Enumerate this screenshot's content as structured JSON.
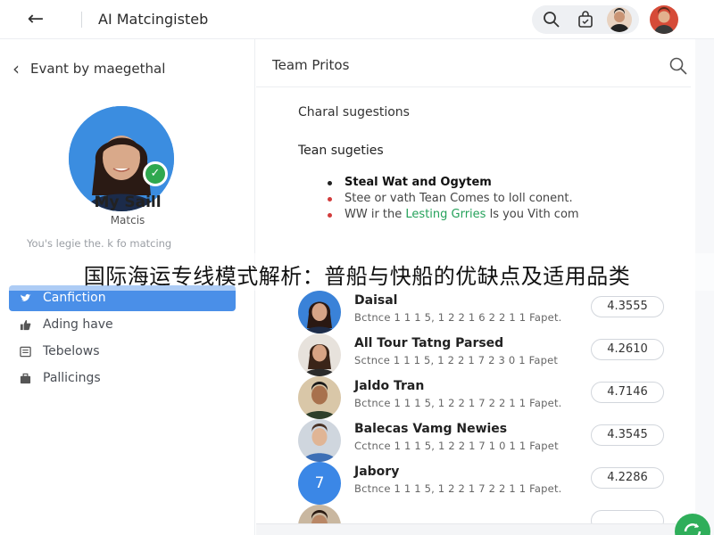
{
  "window": {
    "title": "AI Matcingisteb"
  },
  "left_panel": {
    "header_label": "Evant by maegethal",
    "profile": {
      "name": "My Saill",
      "subtitle": "Matcis",
      "bio": "You's legie the. k fo matcing"
    },
    "nav": [
      {
        "label": "Canfiction",
        "icon": "twitter-icon",
        "active": true
      },
      {
        "label": "Ading have",
        "icon": "thumbs-up-icon",
        "active": false
      },
      {
        "label": "Tebelows",
        "icon": "list-icon",
        "active": false
      },
      {
        "label": "Pallicings",
        "icon": "briefcase-icon",
        "active": false
      }
    ]
  },
  "right_panel": {
    "title": "Team Pritos",
    "section1": "Charal sugestions",
    "section2": "Tean sugeties",
    "bullets": {
      "b1": "Steal Wat and Ogytem",
      "b2": "Stee or vath Tean Comes to loll conent.",
      "b3_pre": "WW ir the ",
      "b3_link": "Lesting Grries",
      "b3_post": " ls you Vith com"
    },
    "people": [
      {
        "name": "Daisal",
        "sub": "Bctnce 1 1 1 5, 1 2 2 1 6  2 2 1 1  Fapet.",
        "score": "4.3555"
      },
      {
        "name": "All Tour Tatng Parsed",
        "sub": "Sctnce 1 1 1 5, 1 2 2 1 7  2 3 0 1  Fapet",
        "score": "4.2610"
      },
      {
        "name": "Jaldo Tran",
        "sub": "Bctnce 1 1 1 5, 1 2 2 1 7  2 2 1 1  Fapet.",
        "score": "4.7146"
      },
      {
        "name": "Balecas Vamg Newies",
        "sub": "Cctnce 1 1 1 5, 1 2 2 1 7  1 0 1 1  Fapet",
        "score": "4.3545"
      },
      {
        "name": "Jabory",
        "sub": "Bctnce 1 1 1 5, 1 2 2 1 7  2 2 1 1  Fapet.",
        "score": "4.2286",
        "avatar_text": "7"
      }
    ]
  },
  "overlay_banner": "国际海运专线模式解析：普船与快船的优缺点及适用品类",
  "colors": {
    "accent_blue": "#4a8fe8",
    "online_green": "#2fa84f",
    "link_green": "#24a15a",
    "bullet_red": "#d23b3b"
  }
}
